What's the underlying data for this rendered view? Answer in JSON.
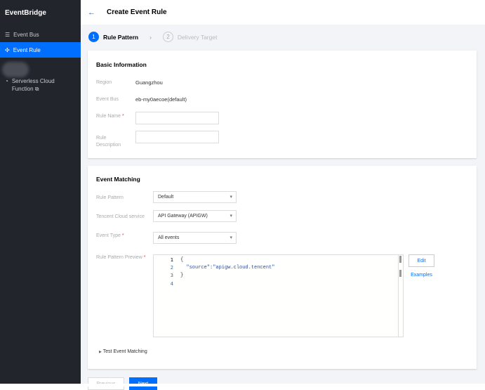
{
  "sidebar": {
    "brand": "EventBridge",
    "items": [
      {
        "label": "Event Bus"
      },
      {
        "label": "Event Rule"
      },
      {
        "label": "Serverless Cloud Function"
      }
    ]
  },
  "header": {
    "title": "Create Event Rule"
  },
  "steps": [
    {
      "num": "1",
      "label": "Rule Pattern"
    },
    {
      "num": "2",
      "label": "Delivery Target"
    }
  ],
  "basic": {
    "title": "Basic Information",
    "region_label": "Region",
    "region": "Guangzhou",
    "bus_label": "Event Bus",
    "bus": "eb-my0aecoe(default)",
    "name_label": "Rule Name",
    "desc_label": "Rule Description",
    "required": "*"
  },
  "matching": {
    "title": "Event Matching",
    "pattern_label": "Rule Pattern",
    "pattern": "Default",
    "service_label": "Tencent Cloud service",
    "service": "API Gateway (APIGW)",
    "type_label": "Event Type",
    "type": "All events",
    "preview_label": "Rule Pattern Preview",
    "lines": [
      "1",
      "2",
      "3",
      "4"
    ],
    "code": [
      "{",
      "  \"source\":\"apigw.cloud.tencent\"",
      "}",
      ""
    ],
    "edit": "Edit",
    "examples": "Examples",
    "test": "Test Event Matching"
  },
  "footer": {
    "previous": "Previous",
    "next": "Next"
  }
}
